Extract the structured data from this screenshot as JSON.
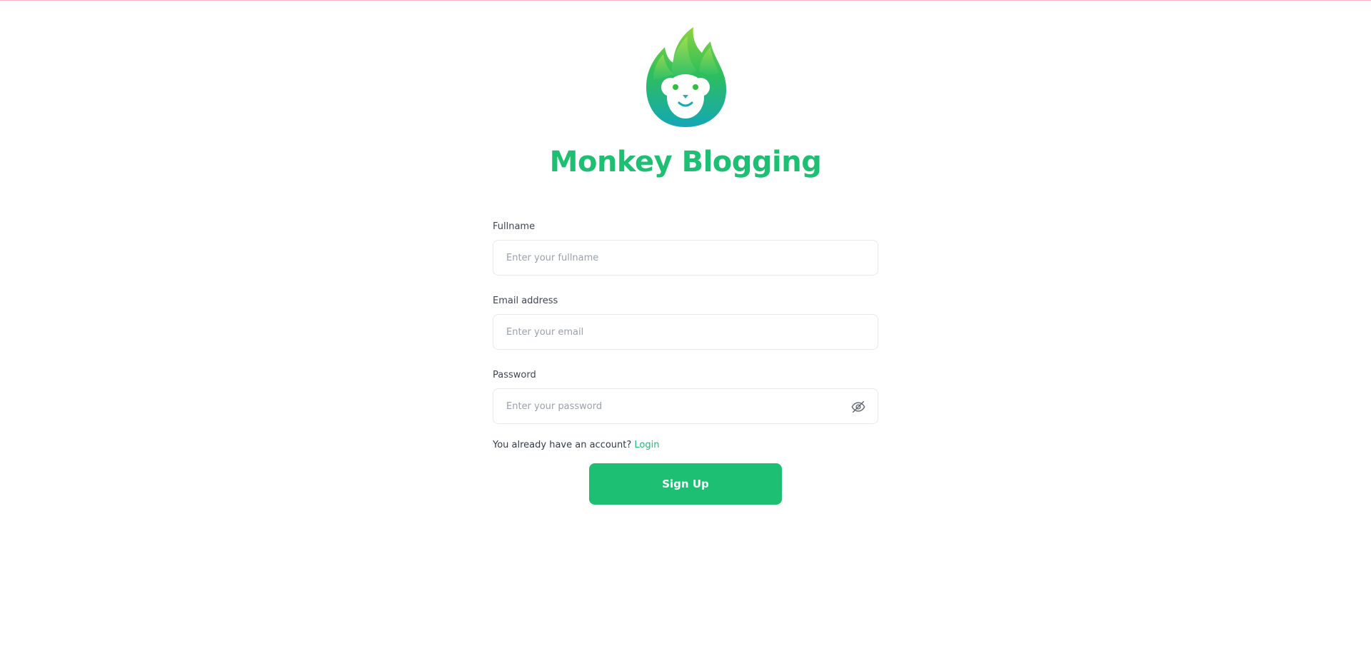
{
  "brand": {
    "title": "Monkey Blogging",
    "logo_icon": "monkey-leaf-logo"
  },
  "form": {
    "fullname": {
      "label": "Fullname",
      "placeholder": "Enter your fullname",
      "value": ""
    },
    "email": {
      "label": "Email address",
      "placeholder": "Enter your email",
      "value": ""
    },
    "password": {
      "label": "Password",
      "placeholder": "Enter your password",
      "value": "",
      "toggle_icon": "eye-slash-icon"
    },
    "account_prompt": "You already have an account?",
    "login_link": "Login",
    "submit_label": "Sign Up"
  },
  "colors": {
    "primary": "#1dbf73",
    "top_border": "#f4b6c2",
    "input_border": "#e6e8ec",
    "placeholder": "#9aa1ab"
  }
}
